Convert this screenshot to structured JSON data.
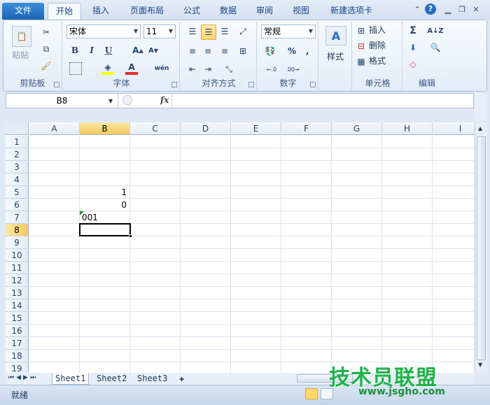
{
  "tabs": [
    "文件",
    "开始",
    "插入",
    "页面布局",
    "公式",
    "数据",
    "审阅",
    "视图",
    "新建选项卡"
  ],
  "groups": {
    "clipboard": {
      "label": "剪贴板",
      "paste": "粘贴"
    },
    "font": {
      "label": "字体",
      "font_name": "宋体",
      "font_size": "11"
    },
    "alignment": {
      "label": "对齐方式"
    },
    "number": {
      "label": "数字",
      "format": "常规"
    },
    "styles": {
      "label": "样式"
    },
    "cells": {
      "label": "单元格",
      "insert": "插入",
      "delete": "删除",
      "format": "格式"
    },
    "editing": {
      "label": "编辑"
    }
  },
  "formula_bar": {
    "name_box": "B8",
    "fx": "fx",
    "formula": ""
  },
  "columns": [
    "A",
    "B",
    "C",
    "D",
    "E",
    "F",
    "G",
    "H",
    "I"
  ],
  "rows": [
    "1",
    "2",
    "3",
    "4",
    "5",
    "6",
    "7",
    "8",
    "9",
    "10",
    "11",
    "12",
    "13",
    "14",
    "15",
    "16",
    "17",
    "18",
    "19"
  ],
  "selected_cell": {
    "col": "B",
    "row": "8"
  },
  "cells": {
    "B5": "1",
    "B6": "0",
    "B7": "001"
  },
  "sheets": [
    "Sheet1",
    "Sheet2",
    "Sheet3"
  ],
  "active_sheet": "Sheet1",
  "status": {
    "ready": "就绪"
  },
  "watermark": {
    "main": "技术员联盟",
    "url": "www.jsgho.com"
  },
  "colors": {
    "selection_header": "#f5c95c",
    "file_tab": "#1b63b8"
  }
}
